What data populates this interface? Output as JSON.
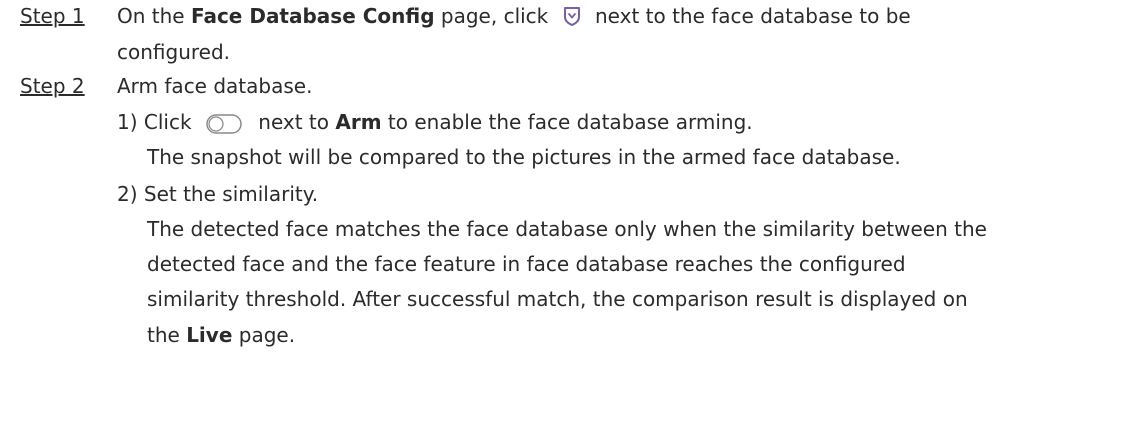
{
  "steps": [
    {
      "label": "Step 1",
      "line1_a": "On the ",
      "line1_bold": "Face Database Config",
      "line1_b": " page, click ",
      "line1_icon": "shield-icon",
      "line1_c": " next to the face database to be",
      "line2": "configured."
    },
    {
      "label": "Step 2",
      "title": "Arm face database.",
      "substeps": [
        {
          "num": "1)",
          "a": "Click ",
          "icon": "toggle-switch-icon",
          "b": " next to ",
          "bold": "Arm",
          "c": " to enable the face database arming.",
          "note": "The snapshot will be compared to the pictures in the armed face database."
        },
        {
          "num": "2)",
          "text": "Set the similarity.",
          "para": [
            "The detected face matches the face database only when the similarity between the",
            "detected face and the face feature in face database reaches the configured",
            "similarity threshold. After successful match, the comparison result is displayed on"
          ],
          "last_a": "the ",
          "last_bold": "Live",
          "last_b": " page."
        }
      ]
    }
  ],
  "colors": {
    "text": "#2b2b2b",
    "icon_stroke": "#7a5fa8",
    "toggle_border": "#8a8a8a"
  }
}
